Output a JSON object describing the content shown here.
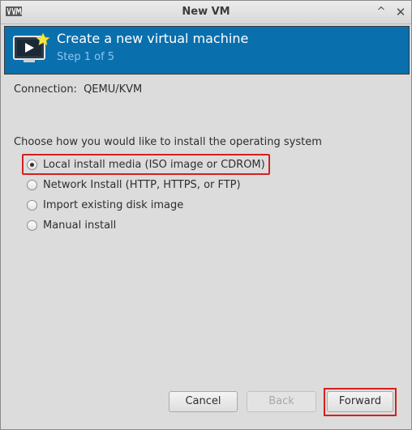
{
  "window": {
    "title": "New VM",
    "maximize_symbol": "^",
    "close_symbol": "✕"
  },
  "header": {
    "title": "Create a new virtual machine",
    "step": "Step 1 of 5"
  },
  "connection": {
    "label": "Connection:",
    "value": "QEMU/KVM"
  },
  "install": {
    "prompt": "Choose how you would like to install the operating system",
    "options": [
      {
        "label": "Local install media (ISO image or CDROM)",
        "selected": true
      },
      {
        "label": "Network Install (HTTP, HTTPS, or FTP)",
        "selected": false
      },
      {
        "label": "Import existing disk image",
        "selected": false
      },
      {
        "label": "Manual install",
        "selected": false
      }
    ]
  },
  "buttons": {
    "cancel": "Cancel",
    "back": "Back",
    "forward": "Forward"
  },
  "colors": {
    "header_bg": "#0a6fad",
    "header_step": "#8cc6ee",
    "highlight": "#d42020"
  },
  "icons": [
    "virt-manager-app-icon",
    "new-vm-monitor-icon",
    "maximize-icon",
    "close-icon"
  ]
}
